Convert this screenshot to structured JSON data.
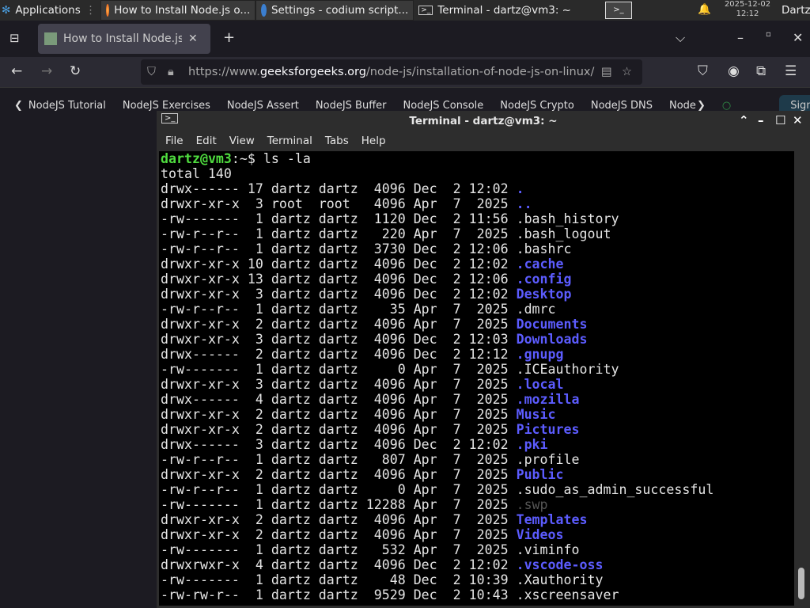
{
  "taskbar": {
    "apps_label": "Applications",
    "tasks": [
      {
        "label": "How to Install Node.js o...",
        "icon": "firefox-icon"
      },
      {
        "label": "Settings - codium script...",
        "icon": "codium-icon"
      },
      {
        "label": "Terminal - dartz@vm3: ~",
        "icon": "terminal-icon"
      }
    ],
    "date": "2025-12-02",
    "time": "12:12",
    "user": "Dartz"
  },
  "browser": {
    "tab_title": "How to Install Node.js on",
    "url_prefix": "https://www.",
    "url_domain": "geeksforgeeks.org",
    "url_path": "/node-js/installation-of-node-js-on-linux/",
    "bookmarks": [
      "NodeJS Tutorial",
      "NodeJS Exercises",
      "NodeJS Assert",
      "NodeJS Buffer",
      "NodeJS Console",
      "NodeJS Crypto",
      "NodeJS DNS",
      "Node"
    ],
    "signin": "Sign In"
  },
  "terminal": {
    "title": "Terminal - dartz@vm3: ~",
    "menu": [
      "File",
      "Edit",
      "View",
      "Terminal",
      "Tabs",
      "Help"
    ],
    "prompt_user": "dartz@vm3",
    "prompt_path": ":~$ ",
    "command": "ls -la",
    "total": "total 140",
    "colors": {
      "dir": "#5c5cff",
      "prompt": "#4fdc3f"
    },
    "entries": [
      {
        "meta": "drwx------ 17 dartz dartz  4096 Dec  2 12:02 ",
        "name": ".",
        "type": "dir"
      },
      {
        "meta": "drwxr-xr-x  3 root  root   4096 Apr  7  2025 ",
        "name": "..",
        "type": "dir"
      },
      {
        "meta": "-rw-------  1 dartz dartz  1120 Dec  2 11:56 ",
        "name": ".bash_history",
        "type": "file"
      },
      {
        "meta": "-rw-r--r--  1 dartz dartz   220 Apr  7  2025 ",
        "name": ".bash_logout",
        "type": "file"
      },
      {
        "meta": "-rw-r--r--  1 dartz dartz  3730 Dec  2 12:06 ",
        "name": ".bashrc",
        "type": "file"
      },
      {
        "meta": "drwxr-xr-x 10 dartz dartz  4096 Dec  2 12:02 ",
        "name": ".cache",
        "type": "dir"
      },
      {
        "meta": "drwxr-xr-x 13 dartz dartz  4096 Dec  2 12:06 ",
        "name": ".config",
        "type": "dir"
      },
      {
        "meta": "drwxr-xr-x  3 dartz dartz  4096 Dec  2 12:02 ",
        "name": "Desktop",
        "type": "dir"
      },
      {
        "meta": "-rw-r--r--  1 dartz dartz    35 Apr  7  2025 ",
        "name": ".dmrc",
        "type": "file"
      },
      {
        "meta": "drwxr-xr-x  2 dartz dartz  4096 Apr  7  2025 ",
        "name": "Documents",
        "type": "dir"
      },
      {
        "meta": "drwxr-xr-x  3 dartz dartz  4096 Dec  2 12:03 ",
        "name": "Downloads",
        "type": "dir"
      },
      {
        "meta": "drwx------  2 dartz dartz  4096 Dec  2 12:12 ",
        "name": ".gnupg",
        "type": "dir"
      },
      {
        "meta": "-rw-------  1 dartz dartz     0 Apr  7  2025 ",
        "name": ".ICEauthority",
        "type": "file"
      },
      {
        "meta": "drwxr-xr-x  3 dartz dartz  4096 Apr  7  2025 ",
        "name": ".local",
        "type": "dir"
      },
      {
        "meta": "drwx------  4 dartz dartz  4096 Apr  7  2025 ",
        "name": ".mozilla",
        "type": "dir"
      },
      {
        "meta": "drwxr-xr-x  2 dartz dartz  4096 Apr  7  2025 ",
        "name": "Music",
        "type": "dir"
      },
      {
        "meta": "drwxr-xr-x  2 dartz dartz  4096 Apr  7  2025 ",
        "name": "Pictures",
        "type": "dir"
      },
      {
        "meta": "drwx------  3 dartz dartz  4096 Dec  2 12:02 ",
        "name": ".pki",
        "type": "dir"
      },
      {
        "meta": "-rw-r--r--  1 dartz dartz   807 Apr  7  2025 ",
        "name": ".profile",
        "type": "file"
      },
      {
        "meta": "drwxr-xr-x  2 dartz dartz  4096 Apr  7  2025 ",
        "name": "Public",
        "type": "dir"
      },
      {
        "meta": "-rw-r--r--  1 dartz dartz     0 Apr  7  2025 ",
        "name": ".sudo_as_admin_successful",
        "type": "file"
      },
      {
        "meta": "-rw-------  1 dartz dartz 12288 Apr  7  2025 ",
        "name": ".swp",
        "type": "faded"
      },
      {
        "meta": "drwxr-xr-x  2 dartz dartz  4096 Apr  7  2025 ",
        "name": "Templates",
        "type": "dir"
      },
      {
        "meta": "drwxr-xr-x  2 dartz dartz  4096 Apr  7  2025 ",
        "name": "Videos",
        "type": "dir"
      },
      {
        "meta": "-rw-------  1 dartz dartz   532 Apr  7  2025 ",
        "name": ".viminfo",
        "type": "file"
      },
      {
        "meta": "drwxrwxr-x  4 dartz dartz  4096 Dec  2 12:02 ",
        "name": ".vscode-oss",
        "type": "dir"
      },
      {
        "meta": "-rw-------  1 dartz dartz    48 Dec  2 10:39 ",
        "name": ".Xauthority",
        "type": "file"
      },
      {
        "meta": "-rw-rw-r--  1 dartz dartz  9529 Dec  2 10:43 ",
        "name": ".xscreensaver",
        "type": "file"
      }
    ]
  }
}
